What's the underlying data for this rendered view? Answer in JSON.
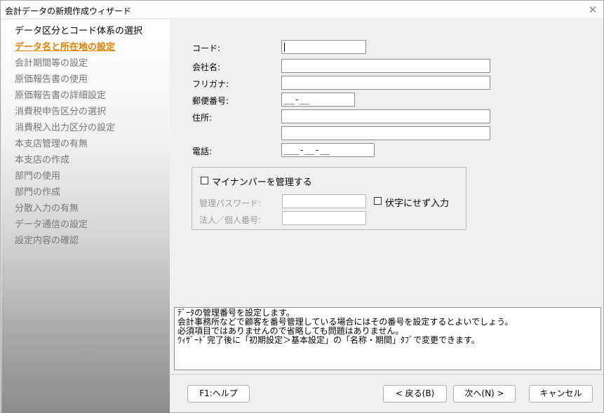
{
  "window": {
    "title": "会計データの新規作成ウィザード",
    "close_glyph": "✕"
  },
  "steps": [
    {
      "label": "データ区分とコード体系の選択",
      "state": "done"
    },
    {
      "label": "データ名と所在地の設定",
      "state": "active"
    },
    {
      "label": "会計期間等の設定",
      "state": "todo"
    },
    {
      "label": "原価報告書の使用",
      "state": "todo"
    },
    {
      "label": "原価報告書の詳細設定",
      "state": "todo"
    },
    {
      "label": "消費税申告区分の選択",
      "state": "todo"
    },
    {
      "label": "消費税入出力区分の設定",
      "state": "todo"
    },
    {
      "label": "本支店管理の有無",
      "state": "todo"
    },
    {
      "label": "本支店の作成",
      "state": "todo"
    },
    {
      "label": "部門の使用",
      "state": "todo"
    },
    {
      "label": "部門の作成",
      "state": "todo"
    },
    {
      "label": "分散入力の有無",
      "state": "todo"
    },
    {
      "label": "データ通信の設定",
      "state": "todo"
    },
    {
      "label": "設定内容の確認",
      "state": "todo"
    }
  ],
  "form": {
    "code_label": "コード:",
    "code_value": "",
    "company_label": "会社名:",
    "company_value": "",
    "furigana_label": "フリガナ:",
    "furigana_value": "",
    "postal_label": "郵便番号:",
    "postal_value": "__-__",
    "address_label": "住所:",
    "address1_value": "",
    "address2_value": "",
    "phone_label": "電話:",
    "phone_value": "___-__-__"
  },
  "mynumber": {
    "manage_label": "マイナンバーを管理する",
    "manage_checked": false,
    "password_label": "管理パスワード:",
    "password_value": "",
    "mask_label": "伏字にせず入力",
    "mask_checked": false,
    "number_label": "法人／個人番号:",
    "number_value": ""
  },
  "description": [
    "ﾃﾞｰﾀの管理番号を設定します。",
    "会計事務所などで顧客を番号管理している場合にはその番号を設定するとよいでしょう。",
    "必須項目ではありませんので省略しても問題はありません。",
    "ｳｨｻﾞｰﾄﾞ完了後に「初期設定＞基本設定」の「名称・期間」ﾀﾌﾞで変更できます。"
  ],
  "buttons": {
    "help": "F1:ヘルプ",
    "back": "< 戻る(B)",
    "next": "次へ(N) >",
    "cancel": "キャンセル"
  }
}
